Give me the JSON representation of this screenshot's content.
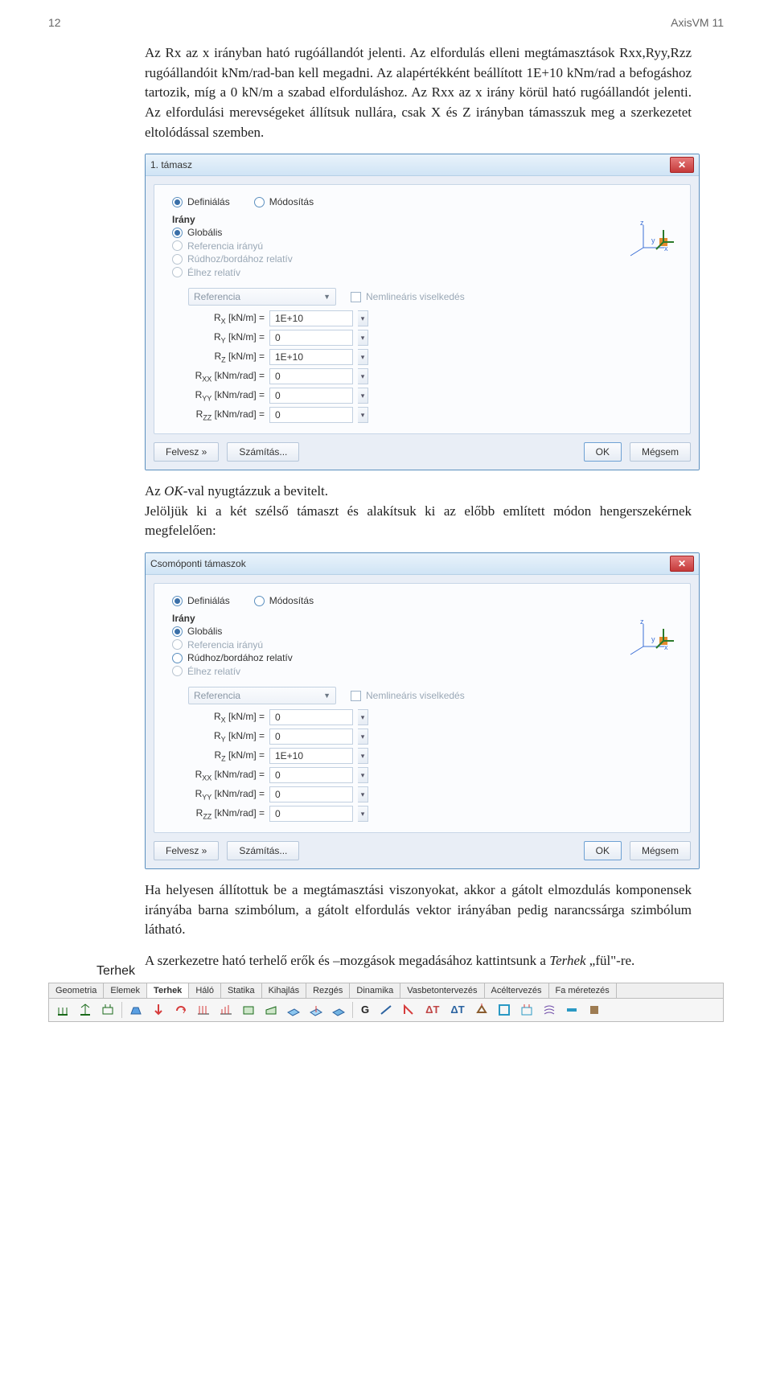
{
  "header": {
    "pageNo": "12",
    "app": "AxisVM 11"
  },
  "text": {
    "p1": "Az Rx az x irányban ható rugóállandót jelenti. Az elfordulás elleni megtámasztások Rxx,Ryy,Rzz rugóállandóit kNm/rad-ban kell megadni. Az alapértékként beállított 1E+10 kNm/rad a befogáshoz tartozik, míg a 0 kN/m a szabad elforduláshoz. Az Rxx az x irány körül ható rugóállandót jelenti. Az elfordulási merevségeket állítsuk nullára, csak X és Z irányban támasszuk meg a szerkezetet eltolódással szemben.",
    "p2a": "Az ",
    "p2b": "OK",
    "p2c": "-val nyugtázzuk a bevitelt.",
    "p3": "Jelöljük ki a két szélső támaszt és alakítsuk ki az előbb említett módon hengerszekérnek megfelelően:",
    "p4": "Ha helyesen állítottuk be a megtámasztási viszonyokat, akkor a gátolt elmozdulás komponensek irányába barna szimbólum, a gátolt elfordulás vektor irányában pedig narancssárga szimbólum látható.",
    "p5a": "A szerkezetre ható terhelő erők és –mozgások megadásához kattintsunk a ",
    "p5b": "Terhek",
    "p5c": " „fül\"-re.",
    "sideLabel": "Terhek"
  },
  "dlg1": {
    "title": "1. támasz",
    "def": "Definiálás",
    "mod": "Módosítás",
    "irany": "Irány",
    "opts": [
      "Globális",
      "Referencia irányú",
      "Rúdhoz/bordához relatív",
      "Élhez relatív"
    ],
    "reference": "Referencia",
    "nonlin": "Nemlineáris viselkedés",
    "rows": [
      {
        "l": "R<sub>X</sub>  [kN/m] =",
        "v": "1E+10"
      },
      {
        "l": "R<sub>Y</sub>  [kN/m] =",
        "v": "0"
      },
      {
        "l": "R<sub>Z</sub>  [kN/m] =",
        "v": "1E+10"
      },
      {
        "l": "R<sub>XX</sub> [kNm/rad] =",
        "v": "0"
      },
      {
        "l": "R<sub>YY</sub> [kNm/rad] =",
        "v": "0"
      },
      {
        "l": "R<sub>ZZ</sub> [kNm/rad] =",
        "v": "0"
      }
    ],
    "felvesz": "Felvesz »",
    "szamitas": "Számítás...",
    "ok": "OK",
    "megsem": "Mégsem"
  },
  "dlg2": {
    "title": "Csomóponti támaszok",
    "def": "Definiálás",
    "mod": "Módosítás",
    "irany": "Irány",
    "opts": [
      "Globális",
      "Referencia irányú",
      "Rúdhoz/bordához relatív",
      "Élhez relatív"
    ],
    "reference": "Referencia",
    "nonlin": "Nemlineáris viselkedés",
    "rows": [
      {
        "l": "R<sub>X</sub>  [kN/m] =",
        "v": "0"
      },
      {
        "l": "R<sub>Y</sub>  [kN/m] =",
        "v": "0"
      },
      {
        "l": "R<sub>Z</sub>  [kN/m] =",
        "v": "1E+10"
      },
      {
        "l": "R<sub>XX</sub> [kNm/rad] =",
        "v": "0"
      },
      {
        "l": "R<sub>YY</sub> [kNm/rad] =",
        "v": "0"
      },
      {
        "l": "R<sub>ZZ</sub> [kNm/rad] =",
        "v": "0"
      }
    ],
    "felvesz": "Felvesz »",
    "szamitas": "Számítás...",
    "ok": "OK",
    "megsem": "Mégsem"
  },
  "tabs": {
    "items": [
      "Geometria",
      "Elemek",
      "Terhek",
      "Háló",
      "Statika",
      "Kihajlás",
      "Rezgés",
      "Dinamika",
      "Vasbetontervezés",
      "Acéltervezés",
      "Fa méretezés"
    ],
    "activeIndex": 2,
    "toolLabels": {
      "G": "G",
      "dT": "ΔT",
      "dT2": "ΔT"
    }
  },
  "axesLabels": {
    "x": "x",
    "y": "y",
    "z": "z"
  }
}
